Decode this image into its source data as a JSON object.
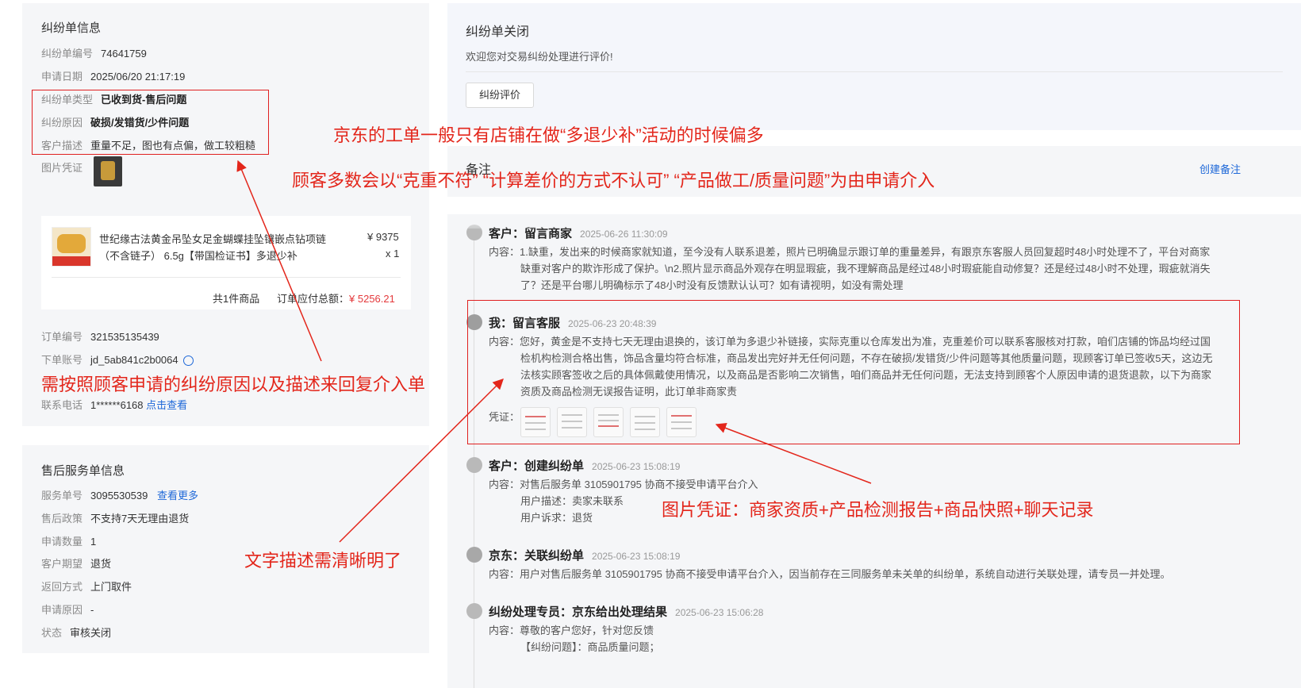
{
  "dispute_info": {
    "title": "纠纷单信息",
    "fields": [
      {
        "label": "纠纷单编号",
        "value": "74641759"
      },
      {
        "label": "申请日期",
        "value": "2025/06/20 21:17:19"
      },
      {
        "label": "纠纷单类型",
        "value": "已收到货-售后问题"
      },
      {
        "label": "纠纷原因",
        "value": "破损/发错货/少件问题"
      },
      {
        "label": "客户描述",
        "value": "重量不足，图也有点偏，做工较粗糙"
      },
      {
        "label": "图片凭证",
        "value": ""
      }
    ],
    "product": {
      "name_line1": "世纪缘古法黄金吊坠女足金蝴蝶挂坠镶嵌点钻项链",
      "name_line2": "（不含链子） 6.5g【带国检证书】多退少补",
      "price": "¥ 9375",
      "qty": "x 1",
      "count_text": "共1件商品",
      "total_label": "订单应付总额：",
      "total_value": "¥ 5256.21"
    },
    "order": [
      {
        "label": "订单编号",
        "value": "321535135439"
      },
      {
        "label": "下单账号",
        "value": "jd_5ab841c2b0064"
      },
      {
        "label": "联系电话",
        "value": "1******6168",
        "link": "点击查看"
      }
    ]
  },
  "after_sale": {
    "title": "售后服务单信息",
    "fields": [
      {
        "label": "服务单号",
        "value": "3095530539",
        "link": "查看更多"
      },
      {
        "label": "售后政策",
        "value": "不支持7天无理由退货"
      },
      {
        "label": "申请数量",
        "value": "1"
      },
      {
        "label": "客户期望",
        "value": "退货"
      },
      {
        "label": "返回方式",
        "value": "上门取件"
      },
      {
        "label": "申请原因",
        "value": "-"
      },
      {
        "label": "状态",
        "value": "审核关闭"
      }
    ]
  },
  "close_panel": {
    "title": "纠纷单关闭",
    "subtitle": "欢迎您对交易纠纷处理进行评价!",
    "button": "纠纷评价"
  },
  "notes": {
    "title": "备注",
    "create_link": "创建备注"
  },
  "logs": [
    {
      "who": "客户：留言商家",
      "time": "2025-06-26 11:30:09",
      "lines": [
        "内容：1.缺重，发出来的时候商家就知道，至今没有人联系退差，照片已明确显示跟订单的重量差异，有跟京东客服人员回复超时48小时处理不了，平台对商家",
        "缺重对客户的欺诈形成了保护。\\n2.照片显示商品外观存在明显瑕疵，我不理解商品是经过48小时瑕疵能自动修复？还是经过48小时不处理，瑕疵就消失",
        "了？还是平台哪儿明确标示了48小时没有反馈默认认可？如有请视明，如没有需处理"
      ]
    },
    {
      "who": "我：留言客服",
      "time": "2025-06-23 20:48:39",
      "lines": [
        "内容：您好，黄金是不支持七天无理由退换的，该订单为多退少补链接，实际克重以仓库发出为准，克重差价可以联系客服核对打款，咱们店铺的饰品均经过国",
        "检机构检测合格出售，饰品含量均符合标准，商品发出完好并无任何问题，不存在破损/发错货/少件问题等其他质量问题，现顾客订单已签收5天，这边无",
        "法核实顾客签收之后的具体佩戴使用情况，以及商品是否影响二次销售，咱们商品并无任何问题，无法支持到顾客个人原因申请的退货退款，以下为商家",
        "资质及商品检测无误报告证明，此订单非商家责"
      ],
      "evidence_label": "凭证："
    },
    {
      "who": "客户：创建纠纷单",
      "time": "2025-06-23 15:08:19",
      "lines": [
        "内容：对售后服务单 3105901795 协商不接受申请平台介入",
        "用户描述：卖家未联系",
        "用户诉求：退货"
      ]
    },
    {
      "who": "京东：关联纠纷单",
      "time": "2025-06-23 15:08:19",
      "lines": [
        "内容：用户对售后服务单 3105901795 协商不接受申请平台介入，因当前存在三同服务单未关单的纠纷单，系统自动进行关联处理，请专员一并处理。"
      ]
    },
    {
      "who": "纠纷处理专员：京东给出处理结果",
      "time": "2025-06-23 15:06:28",
      "lines": [
        "内容：尊敬的客户您好，针对您反馈",
        "【纠纷问题】：商品质量问题；"
      ]
    }
  ],
  "annotations": {
    "a1": "京东的工单一般只有店铺在做“多退少补”活动的时候偏多",
    "a2": "顾客多数会以“克重不符” “计算差价的方式不认可” “产品做工/质量问题”为由申请介入",
    "a3": "需按照顾客申请的纠纷原因以及描述来回复介入单",
    "a4": "文字描述需清晰明了",
    "a5": "图片凭证：商家资质+产品检测报告+商品快照+聊天记录"
  },
  "colors": {
    "annotation": "#e3261b",
    "link": "#1e68d8",
    "price": "#e4393c",
    "panel": "#f5f6f8"
  }
}
